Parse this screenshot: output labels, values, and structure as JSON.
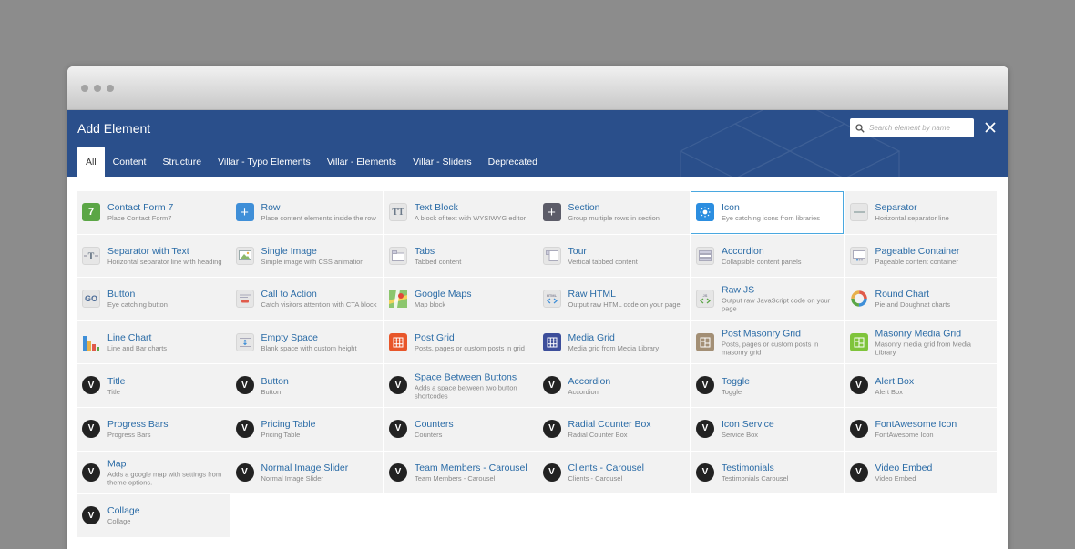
{
  "header": {
    "title": "Add Element"
  },
  "search": {
    "placeholder": "Search element by name"
  },
  "tabs": [
    "All",
    "Content",
    "Structure",
    "Villar - Typo Elements",
    "Villar - Elements",
    "Villar - Sliders",
    "Deprecated"
  ],
  "colors": {
    "header_bg": "#2a4f8b",
    "accent_link": "#2a6ba6",
    "selected_border": "#4aa8e0"
  },
  "elements": [
    {
      "name": "Contact Form 7",
      "desc": "Place Contact Form7",
      "icon": "contact-form-7-icon"
    },
    {
      "name": "Row",
      "desc": "Place content elements inside the row",
      "icon": "plus-icon"
    },
    {
      "name": "Text Block",
      "desc": "A block of text with WYSIWYG editor",
      "icon": "text-icon"
    },
    {
      "name": "Section",
      "desc": "Group multiple rows in section",
      "icon": "plus-icon"
    },
    {
      "name": "Icon",
      "desc": "Eye catching icons from libraries",
      "icon": "sun-icon"
    },
    {
      "name": "Separator",
      "desc": "Horizontal separator line",
      "icon": "separator-icon"
    },
    {
      "name": "Separator with Text",
      "desc": "Horizontal separator line with heading",
      "icon": "separator-text-icon"
    },
    {
      "name": "Single Image",
      "desc": "Simple image with CSS animation",
      "icon": "image-icon"
    },
    {
      "name": "Tabs",
      "desc": "Tabbed content",
      "icon": "tabs-icon"
    },
    {
      "name": "Tour",
      "desc": "Vertical tabbed content",
      "icon": "tour-icon"
    },
    {
      "name": "Accordion",
      "desc": "Collapsible content panels",
      "icon": "accordion-icon"
    },
    {
      "name": "Pageable Container",
      "desc": "Pageable content container",
      "icon": "pageable-icon"
    },
    {
      "name": "Button",
      "desc": "Eye catching button",
      "icon": "go-button-icon"
    },
    {
      "name": "Call to Action",
      "desc": "Catch visitors attention with CTA block",
      "icon": "cta-icon"
    },
    {
      "name": "Google Maps",
      "desc": "Map block",
      "icon": "map-icon"
    },
    {
      "name": "Raw HTML",
      "desc": "Output raw HTML code on your page",
      "icon": "html-code-icon"
    },
    {
      "name": "Raw JS",
      "desc": "Output raw JavaScript code on your page",
      "icon": "js-code-icon"
    },
    {
      "name": "Round Chart",
      "desc": "Pie and Doughnat charts",
      "icon": "round-chart-icon"
    },
    {
      "name": "Line Chart",
      "desc": "Line and Bar charts",
      "icon": "bar-chart-icon"
    },
    {
      "name": "Empty Space",
      "desc": "Blank space with custom height",
      "icon": "empty-space-icon"
    },
    {
      "name": "Post Grid",
      "desc": "Posts, pages or custom posts in grid",
      "icon": "grid-icon"
    },
    {
      "name": "Media Grid",
      "desc": "Media grid from Media Library",
      "icon": "grid-icon"
    },
    {
      "name": "Post Masonry Grid",
      "desc": "Posts, pages or custom posts in masonry grid",
      "icon": "grid-icon"
    },
    {
      "name": "Masonry Media Grid",
      "desc": "Masonry media grid from Media Library",
      "icon": "grid-icon"
    },
    {
      "name": "Title",
      "desc": "Title",
      "icon": "villar-icon"
    },
    {
      "name": "Button",
      "desc": "Button",
      "icon": "villar-icon"
    },
    {
      "name": "Space Between Buttons",
      "desc": "Adds a space between two button shortcodes",
      "icon": "villar-icon"
    },
    {
      "name": "Accordion",
      "desc": "Accordion",
      "icon": "villar-icon"
    },
    {
      "name": "Toggle",
      "desc": "Toggle",
      "icon": "villar-icon"
    },
    {
      "name": "Alert Box",
      "desc": "Alert Box",
      "icon": "villar-icon"
    },
    {
      "name": "Progress Bars",
      "desc": "Progress Bars",
      "icon": "villar-icon"
    },
    {
      "name": "Pricing Table",
      "desc": "Pricing Table",
      "icon": "villar-icon"
    },
    {
      "name": "Counters",
      "desc": "Counters",
      "icon": "villar-icon"
    },
    {
      "name": "Radial Counter Box",
      "desc": "Radial Counter Box",
      "icon": "villar-icon"
    },
    {
      "name": "Icon Service",
      "desc": "Service Box",
      "icon": "villar-icon"
    },
    {
      "name": "FontAwesome Icon",
      "desc": "FontAwesome Icon",
      "icon": "villar-icon"
    },
    {
      "name": "Map",
      "desc": "Adds a google map with settings from theme options.",
      "icon": "villar-icon"
    },
    {
      "name": "Normal Image Slider",
      "desc": "Normal Image Slider",
      "icon": "villar-icon"
    },
    {
      "name": "Team Members - Carousel",
      "desc": "Team Members - Carousel",
      "icon": "villar-icon"
    },
    {
      "name": "Clients - Carousel",
      "desc": "Clients - Carousel",
      "icon": "villar-icon"
    },
    {
      "name": "Testimonials",
      "desc": "Testimonials Carousel",
      "icon": "villar-icon"
    },
    {
      "name": "Video Embed",
      "desc": "Video Embed",
      "icon": "villar-icon"
    },
    {
      "name": "Collage",
      "desc": "Collage",
      "icon": "villar-icon"
    }
  ],
  "glyphs": {
    "cf7": "7",
    "plus": "+",
    "text": "TT",
    "go": "GO",
    "villar": "V",
    "html": "HTML",
    "js": "JS"
  }
}
